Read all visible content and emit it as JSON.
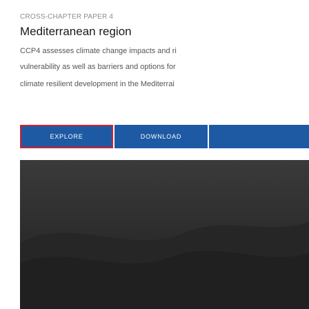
{
  "header": {
    "kicker": "CROSS-CHAPTER PAPER 4",
    "title": "Mediterranean region"
  },
  "intro": {
    "line1": "CCP4 assesses climate change impacts and ri",
    "line2": "vulnerability as well as barriers and options for",
    "line3": "climate resilient development in the Mediterrai"
  },
  "actions": {
    "explore_label": "EXPLORE",
    "download_label": "DOWNLOAD",
    "third_label": ""
  },
  "colors": {
    "button_bg": "#1e5aa3",
    "focus_outline": "#d81e2a",
    "image_bg": "#2b2b2b"
  }
}
